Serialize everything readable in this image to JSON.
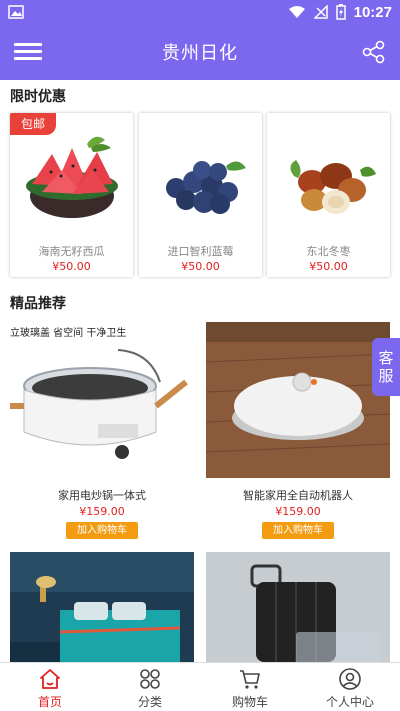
{
  "status_bar": {
    "time": "10:27"
  },
  "app_bar": {
    "title": "贵州日化"
  },
  "sections": {
    "flash_sale": "限时优惠",
    "featured": "精品推荐"
  },
  "flash_sale": [
    {
      "badge": "包邮",
      "name": "海南无籽西瓜",
      "price": "¥50.00"
    },
    {
      "name": "进口智利蓝莓",
      "price": "¥50.00"
    },
    {
      "name": "东北冬枣",
      "price": "¥50.00"
    }
  ],
  "products": [
    {
      "caption": "立玻璃盖 省空间 干净卫生",
      "name": "家用电炒锅一体式",
      "price": "¥159.00",
      "button": "加入购物车"
    },
    {
      "name": "智能家用全自动机器人",
      "price": "¥159.00",
      "button": "加入购物车"
    },
    {
      "name": "",
      "price": ""
    },
    {
      "name": "",
      "price": ""
    }
  ],
  "service": {
    "line1": "客",
    "line2": "服"
  },
  "tabs": [
    {
      "label": "首页",
      "icon": "home-icon",
      "active": true
    },
    {
      "label": "分类",
      "icon": "category-icon",
      "active": false
    },
    {
      "label": "购物车",
      "icon": "cart-icon",
      "active": false
    },
    {
      "label": "个人中心",
      "icon": "user-icon",
      "active": false
    }
  ],
  "colors": {
    "primary": "#7b68ee",
    "price": "#e02020",
    "button": "#f39c12",
    "badge": "#e8413a"
  }
}
